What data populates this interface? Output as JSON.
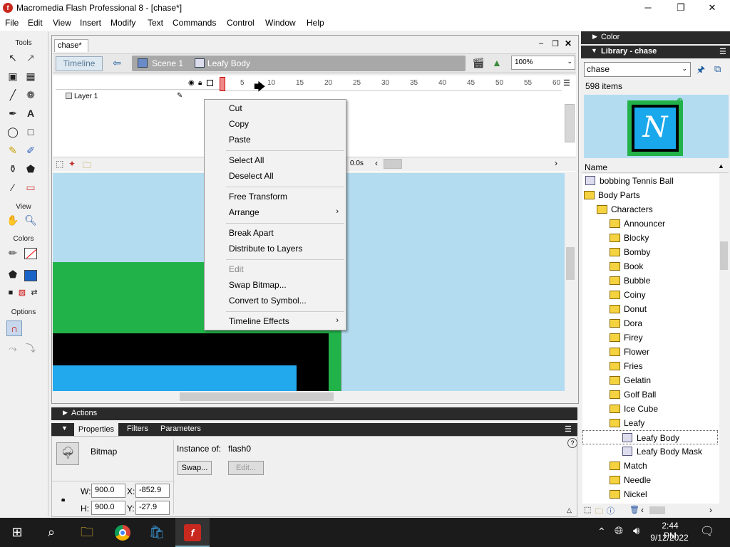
{
  "window": {
    "title": "Macromedia Flash Professional 8 - [chase*]",
    "app_icon": "f",
    "minimize": "─",
    "restore": "❐",
    "close": "✕"
  },
  "menubar": [
    "File",
    "Edit",
    "View",
    "Insert",
    "Modify",
    "Text",
    "Commands",
    "Control",
    "Window",
    "Help"
  ],
  "tools": {
    "header": "Tools",
    "view_header": "View",
    "colors_header": "Colors",
    "options_header": "Options"
  },
  "document": {
    "tab": "chase*",
    "timeline_button": "Timeline",
    "scene": "Scene 1",
    "symbol": "Leafy Body",
    "zoom": "100%"
  },
  "timeline": {
    "layer_name": "Layer 1",
    "ruler_ticks": [
      "5",
      "10",
      "15",
      "20",
      "25",
      "30",
      "35",
      "40",
      "45",
      "50",
      "55",
      "60"
    ],
    "time": "0.0s"
  },
  "context_menu": {
    "items": [
      "Cut",
      "Copy",
      "Paste",
      "Select All",
      "Deselect All",
      "Free Transform",
      "Arrange",
      "Break Apart",
      "Distribute to Layers",
      "Edit",
      "Swap Bitmap...",
      "Convert to Symbol...",
      "Timeline Effects"
    ],
    "disabled": [
      "Edit"
    ],
    "submenus": [
      "Arrange",
      "Timeline Effects"
    ]
  },
  "panels": {
    "actions": "Actions",
    "properties_tab": "Properties",
    "filters_tab": "Filters",
    "parameters_tab": "Parameters"
  },
  "properties": {
    "type": "Bitmap",
    "instance_label": "Instance of:",
    "instance_value": "flash0",
    "swap_button": "Swap...",
    "edit_button": "Edit...",
    "w_label": "W:",
    "w_value": "900.0",
    "x_label": "X:",
    "x_value": "-852.9",
    "h_label": "H:",
    "h_value": "900.0",
    "y_label": "Y:",
    "y_value": "-27.9"
  },
  "color_panel": {
    "title": "Color"
  },
  "library": {
    "title": "Library - chase",
    "selected": "chase",
    "count": "598 items",
    "name_header": "Name",
    "items": [
      {
        "label": "bobbing Tennis Ball",
        "kind": "symbol",
        "indent": 0
      },
      {
        "label": "Body Parts",
        "kind": "open-folder",
        "indent": 0
      },
      {
        "label": "Characters",
        "kind": "open-folder",
        "indent": 1
      },
      {
        "label": "Announcer",
        "kind": "folder",
        "indent": 2
      },
      {
        "label": "Blocky",
        "kind": "folder",
        "indent": 2
      },
      {
        "label": "Bomby",
        "kind": "folder",
        "indent": 2
      },
      {
        "label": "Book",
        "kind": "folder",
        "indent": 2
      },
      {
        "label": "Bubble",
        "kind": "folder",
        "indent": 2
      },
      {
        "label": "Coiny",
        "kind": "folder",
        "indent": 2
      },
      {
        "label": "Donut",
        "kind": "folder",
        "indent": 2
      },
      {
        "label": "Dora",
        "kind": "folder",
        "indent": 2
      },
      {
        "label": "Firey",
        "kind": "folder",
        "indent": 2
      },
      {
        "label": "Flower",
        "kind": "folder",
        "indent": 2
      },
      {
        "label": "Fries",
        "kind": "folder",
        "indent": 2
      },
      {
        "label": "Gelatin",
        "kind": "folder",
        "indent": 2
      },
      {
        "label": "Golf Ball",
        "kind": "folder",
        "indent": 2
      },
      {
        "label": "Ice Cube",
        "kind": "folder",
        "indent": 2
      },
      {
        "label": "Leafy",
        "kind": "open-folder",
        "indent": 2
      },
      {
        "label": "Leafy Body",
        "kind": "symbol",
        "indent": 3
      },
      {
        "label": "Leafy Body Mask",
        "kind": "symbol",
        "indent": 3
      },
      {
        "label": "Match",
        "kind": "folder",
        "indent": 2
      },
      {
        "label": "Needle",
        "kind": "folder",
        "indent": 2
      },
      {
        "label": "Nickel",
        "kind": "folder",
        "indent": 2
      }
    ]
  },
  "taskbar": {
    "time": "2:44 PM",
    "date": "9/12/2022"
  }
}
